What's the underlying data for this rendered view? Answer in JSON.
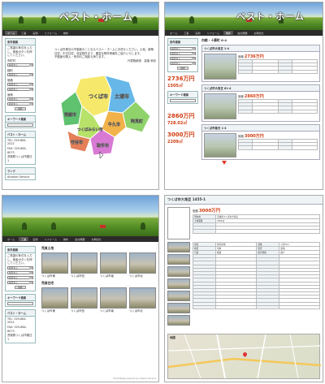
{
  "site": {
    "logo": "ベスト・ホーム",
    "nav": [
      "ホーム",
      "工事",
      "実例",
      "リフォーム",
      "物件",
      "会社概要",
      "お問合せ"
    ],
    "side": {
      "search_title": "条件検索",
      "intro": "ご希望の条件を入力し、検索ボタンを押してください。",
      "f1": "市町村",
      "f2": "種別",
      "f3": "価格",
      "f4": "面積",
      "opt": "指定なし",
      "search_btn": "検索",
      "keyword_title": "キーワード検索",
      "company": "ベスト・ホーム",
      "tel": "TEL: 029-864-2022",
      "fax": "FAX: 029-864-8073",
      "addr": "茨城県つくば市春日 1",
      "rank_title": "ランク",
      "link": "Amazon Service"
    }
  },
  "p1": {
    "intro": "つくば市周辺の不動産のことならベスト・ホームにお任せください。土地、新築住宅、中古住宅、収益物件まで、豊富な物件情報をご紹介いたします。",
    "sub": "不動産の購入・売却のご相談も承ります。",
    "credit": "代表取締役　高橋 和也",
    "regions": [
      "つくば市",
      "土浦市",
      "牛久市",
      "阿見町",
      "常総市",
      "つくばみらい市",
      "守谷市",
      "取手市"
    ]
  },
  "p2": {
    "header": "内緒・十壽町 6-4",
    "listings": [
      {
        "title": "つくば市大角豆 1-4",
        "price": "2736万円",
        "area": "1505㎡",
        "label": "価格"
      },
      {
        "title": "つくば市大角豆 61-4",
        "price": "2860万円",
        "area": "728.02㎡",
        "label": "価格"
      },
      {
        "title": "つくば市春日 1-4",
        "price": "3000万円",
        "area": "2209㎡",
        "label": "価格"
      }
    ],
    "detail_price": "2736万円",
    "detail_area": "1505㎡"
  },
  "p3": {
    "sec1": "売買土地",
    "sec2": "売買住宅",
    "thumbs": [
      "つくば市東",
      "つくば市西",
      "つくば市南",
      "つくば市北"
    ],
    "footer": "PhotoStage powered by Amazon Service"
  },
  "p4": {
    "title": "つくば市大角豆 1455-1",
    "price_label": "価格",
    "price": "3000万円",
    "rows": [
      [
        "所在地",
        "茨城県つくば市大角豆"
      ],
      [
        "土地面積",
        "1505㎡"
      ],
      [
        "用途",
        "住宅用地"
      ],
      [
        "道路",
        "公道 6m"
      ],
      [
        "地目",
        "宅地"
      ],
      [
        "現況",
        "更地"
      ],
      [
        "引渡",
        "相談"
      ],
      [
        "取引態様",
        "媒介"
      ]
    ],
    "map_label": "地図"
  }
}
